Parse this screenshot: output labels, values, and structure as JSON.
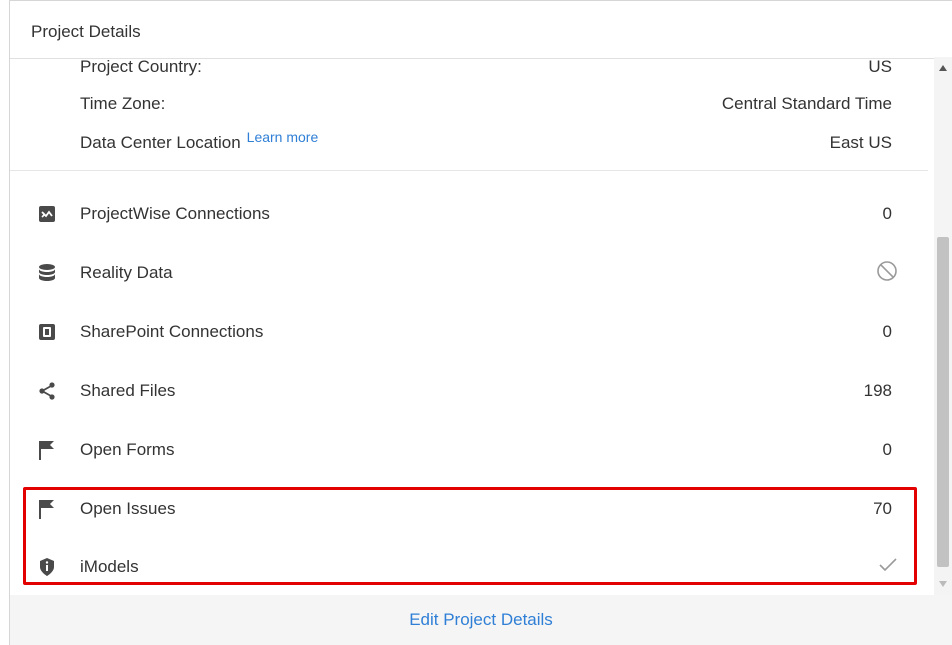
{
  "panel": {
    "title": "Project Details"
  },
  "details": [
    {
      "label": "Project Country:",
      "value": "US"
    },
    {
      "label": "Time Zone:",
      "value": "Central Standard Time"
    },
    {
      "label": "Data Center Location",
      "link": "Learn more",
      "value": "East US"
    }
  ],
  "services": [
    {
      "label": "ProjectWise Connections",
      "value": "0",
      "icon": "projectwise-icon"
    },
    {
      "label": "Reality Data",
      "value": "",
      "status_icon": "prohibited-icon",
      "icon": "database-icon"
    },
    {
      "label": "SharePoint Connections",
      "value": "0",
      "icon": "sharepoint-icon"
    },
    {
      "label": "Shared Files",
      "value": "198",
      "icon": "share-icon"
    },
    {
      "label": "Open Forms",
      "value": "0",
      "icon": "flag-icon"
    },
    {
      "label": "Open Issues",
      "value": "70",
      "icon": "flag-icon"
    },
    {
      "label": "iModels",
      "value": "",
      "status_icon": "checkmark-icon",
      "icon": "info-shield-icon"
    }
  ],
  "footer": {
    "edit_label": "Edit Project Details"
  },
  "colors": {
    "link": "#2f7fd6",
    "highlight": "#e30000",
    "icon": "#4a4a4a"
  }
}
